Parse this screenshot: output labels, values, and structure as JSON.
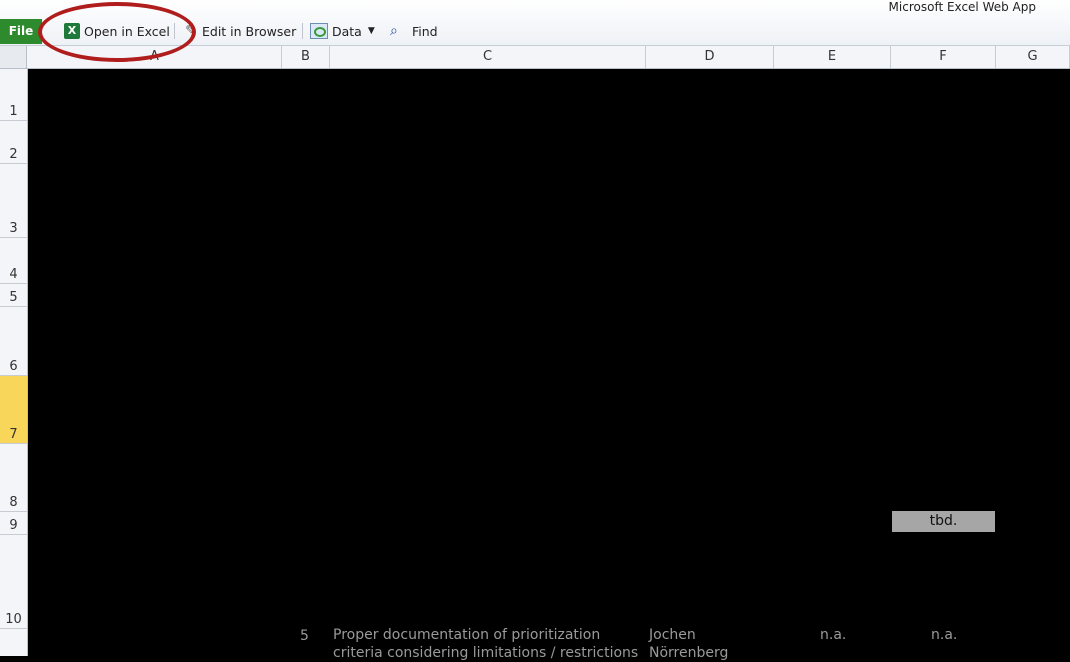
{
  "app_title": "Microsoft Excel Web App",
  "toolbar": {
    "file_label": "File",
    "open_in_excel_label": "Open in Excel",
    "edit_in_browser_label": "Edit in Browser",
    "data_label": "Data",
    "find_label": "Find"
  },
  "columns": [
    "A",
    "B",
    "C",
    "D",
    "E",
    "F",
    "G"
  ],
  "rows": [
    "1",
    "2",
    "3",
    "4",
    "5",
    "6",
    "7",
    "8",
    "9",
    "10"
  ],
  "selected_row": "7",
  "cells": {
    "f9": "tbd.",
    "b10": "5",
    "c10_line1": "Proper documentation of prioritization",
    "c10_line2": "criteria considering limitations / restrictions",
    "d10_line1": "Jochen",
    "d10_line2": "Nörrenberg",
    "e10": "n.a.",
    "f10": "n.a."
  },
  "colors": {
    "file_tab": "#2d8a2d",
    "highlight_circle": "#b01d1d",
    "selected_row": "#f7d65a"
  }
}
